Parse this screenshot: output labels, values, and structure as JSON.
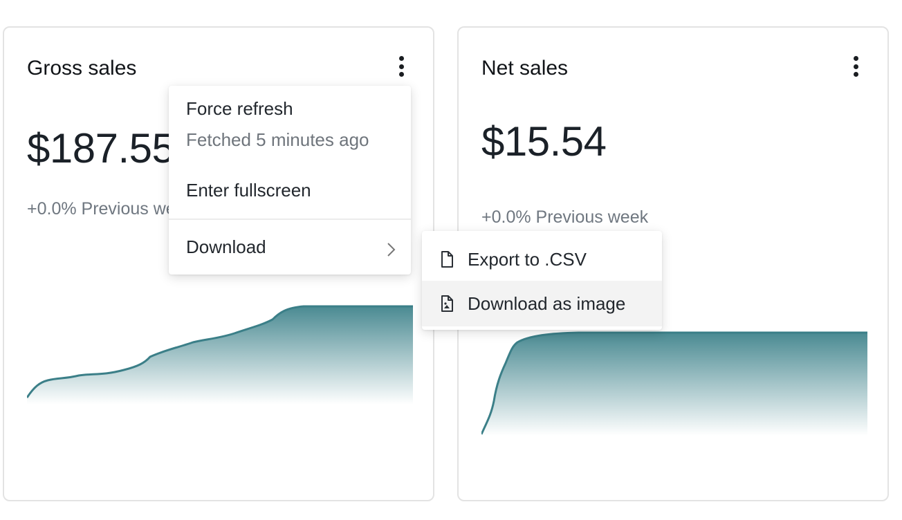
{
  "cards": {
    "gross": {
      "title": "Gross sales",
      "value": "$187.55",
      "delta": "+0.0% Previous week"
    },
    "net": {
      "title": "Net sales",
      "value": "$15.54",
      "delta": "+0.0% Previous week"
    }
  },
  "context_menu": {
    "force_refresh": "Force refresh",
    "fetched_status": "Fetched 5 minutes ago",
    "enter_fullscreen": "Enter fullscreen",
    "download": "Download"
  },
  "download_submenu": {
    "export_csv": "Export to .CSV",
    "download_image": "Download as image"
  },
  "colors": {
    "accent_line": "#3b7f88",
    "accent_fill": "#4a8a92",
    "card_border": "#e3e3e3"
  },
  "icons": {
    "kebab": "vertical-dots-icon",
    "chevron": "chevron-right-icon",
    "file": "file-icon",
    "image_file": "image-file-icon"
  }
}
